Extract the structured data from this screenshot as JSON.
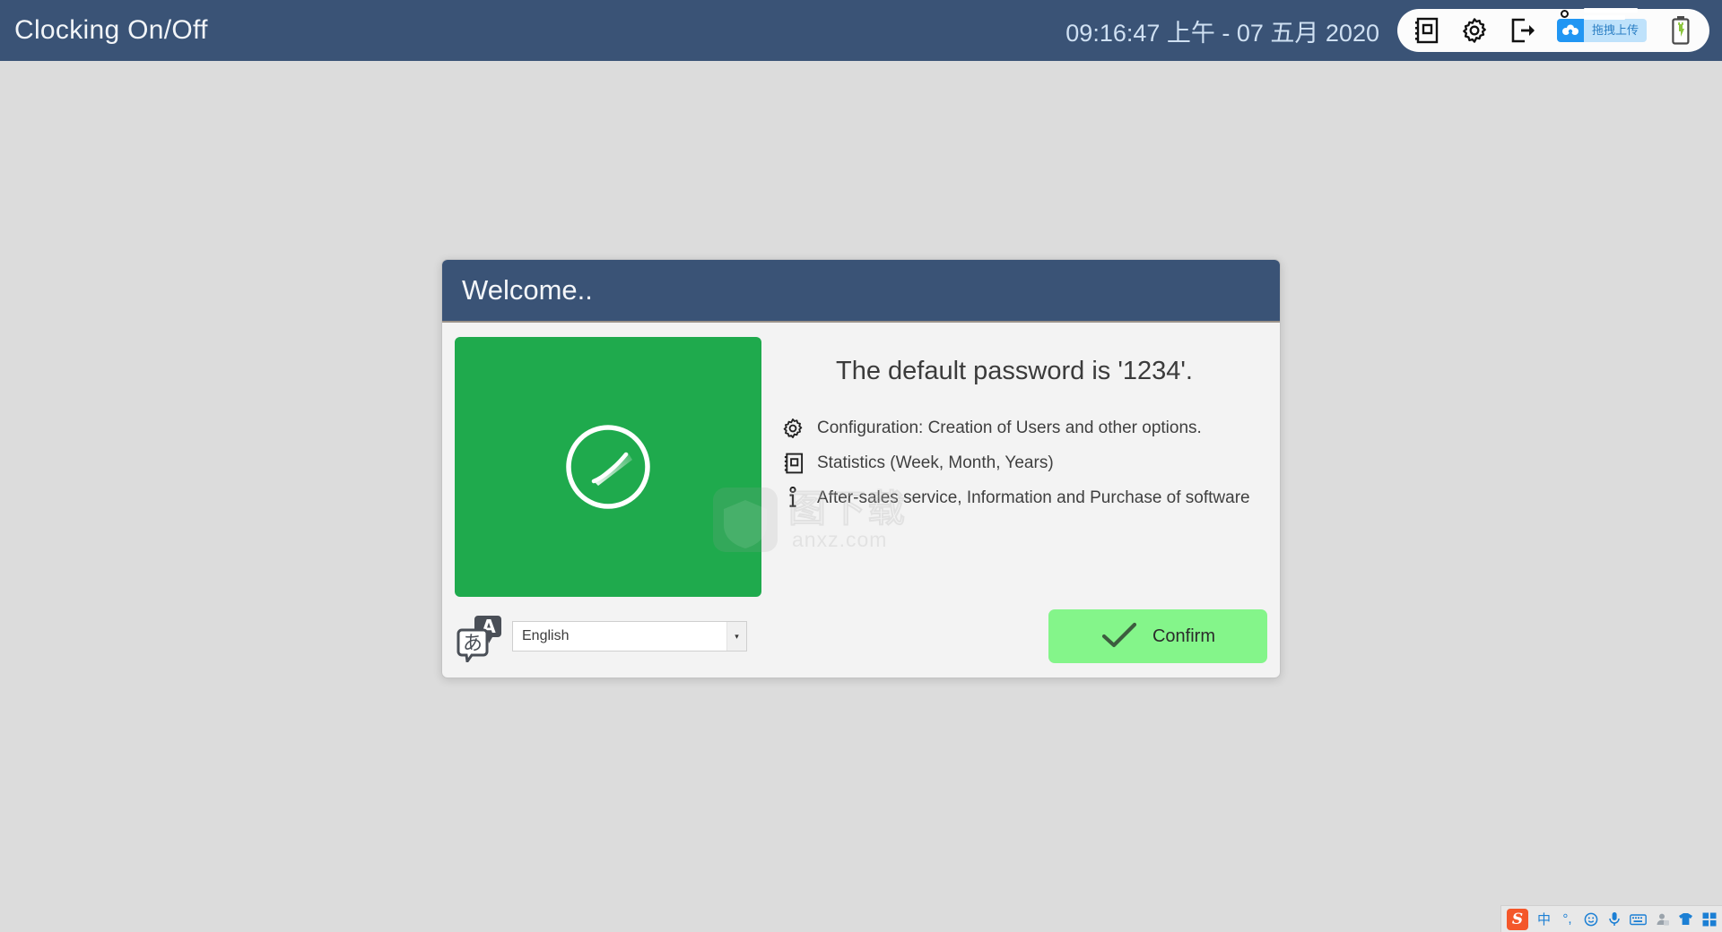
{
  "appbar": {
    "title": "Clocking On/Off",
    "clock": "09:16:47 上午 - 07 五月 2020",
    "tray": {
      "statistics_icon": "statistics-book-icon",
      "settings_icon": "gear-icon",
      "logout_icon": "logout-icon",
      "upload_label": "拖拽上传",
      "cloud_icon": "cloud-icon",
      "battery_icon": "battery-charging-icon"
    }
  },
  "dialog": {
    "title": "Welcome..",
    "clock_panel": {
      "icon": "clock-radar-icon",
      "color": "#1faa4d"
    },
    "password_message": "The default password is '1234'.",
    "features": [
      {
        "icon": "gear-icon",
        "text": "Configuration: Creation of Users and other options."
      },
      {
        "icon": "statistics-book-icon",
        "text": "Statistics (Week, Month, Years)"
      },
      {
        "icon": "info-icon",
        "text": "After-sales service, Information and Purchase of software"
      }
    ],
    "language": {
      "icon": "translate-icon",
      "value": "English",
      "options": [
        "English"
      ],
      "arrow": "▾"
    },
    "confirm": {
      "label": "Confirm",
      "icon": "check-icon",
      "color": "#84f58a"
    }
  },
  "watermark": {
    "cn": "图下载",
    "site": "anxz.com"
  },
  "ime": {
    "logo": "S",
    "items": [
      {
        "name": "chinese-mode",
        "label": "中"
      },
      {
        "name": "punctuation-mode",
        "label": "°,"
      },
      {
        "name": "emoji-icon",
        "label": "☺"
      },
      {
        "name": "microphone-icon",
        "label": "🎤"
      },
      {
        "name": "keyboard-icon",
        "label": "⌨"
      },
      {
        "name": "user-icon",
        "label": "👤"
      },
      {
        "name": "skin-icon",
        "label": "👕"
      },
      {
        "name": "toolbox-icon",
        "label": "▦"
      }
    ]
  },
  "colors": {
    "header": "#3a5376",
    "desktop": "#dcdcdc",
    "green": "#1faa4d",
    "confirm_green": "#84f58a",
    "accent_blue": "#2196f3"
  }
}
